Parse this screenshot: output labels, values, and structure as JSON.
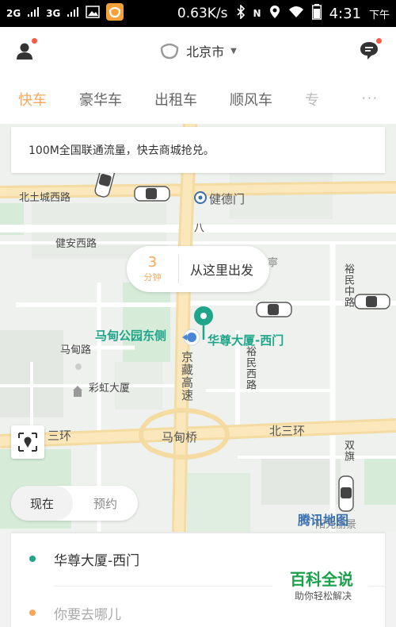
{
  "status_bar": {
    "net1": "2G",
    "net2": "3G",
    "speed": "0.63K/s",
    "nfc": "N",
    "time": "4:31",
    "ampm": "下午"
  },
  "header": {
    "city": "北京市"
  },
  "tabs": [
    {
      "label": "快车",
      "active": true
    },
    {
      "label": "豪华车",
      "active": false
    },
    {
      "label": "出租车",
      "active": false
    },
    {
      "label": "顺风车",
      "active": false
    },
    {
      "label": "专",
      "active": false
    }
  ],
  "more_label": "···",
  "promo": {
    "text": "100M全国联通流量，快去商城抢兑。"
  },
  "map": {
    "labels": {
      "beituchenglu": "北土城西路",
      "jiandemen": "健德门",
      "jiananxilu": "健安西路",
      "madiangongyuan": "马甸公园东侧",
      "huazundasha": "华尊大厦-西门",
      "madianlu": "马甸路",
      "caihongdasha": "彩虹大厦",
      "yuminxilu": "裕民西路",
      "yuminzhonglu": "裕民中路",
      "jingzanggaosu": "京藏高速",
      "madianqiao": "马甸桥",
      "beisanhuan": "北三环",
      "sanhuan": "三环",
      "shuangqi": "双旗",
      "ba": "八",
      "ning": "寧",
      "yangguang": "阳光丽景"
    },
    "pickup": {
      "eta_value": "3",
      "eta_unit": "分钟",
      "text": "从这里出发"
    },
    "tencent_map": "腾讯地图",
    "accent_color": "#1fa58a"
  },
  "time_toggle": {
    "now": "现在",
    "later": "预约"
  },
  "route": {
    "from": "华尊大厦-西门",
    "to_placeholder": "你要去哪儿",
    "from_dot_color": "#1fa58a",
    "to_dot_color": "#f8a85b"
  },
  "watermark": {
    "title": "百科全说",
    "subtitle": "助你轻松解决"
  }
}
